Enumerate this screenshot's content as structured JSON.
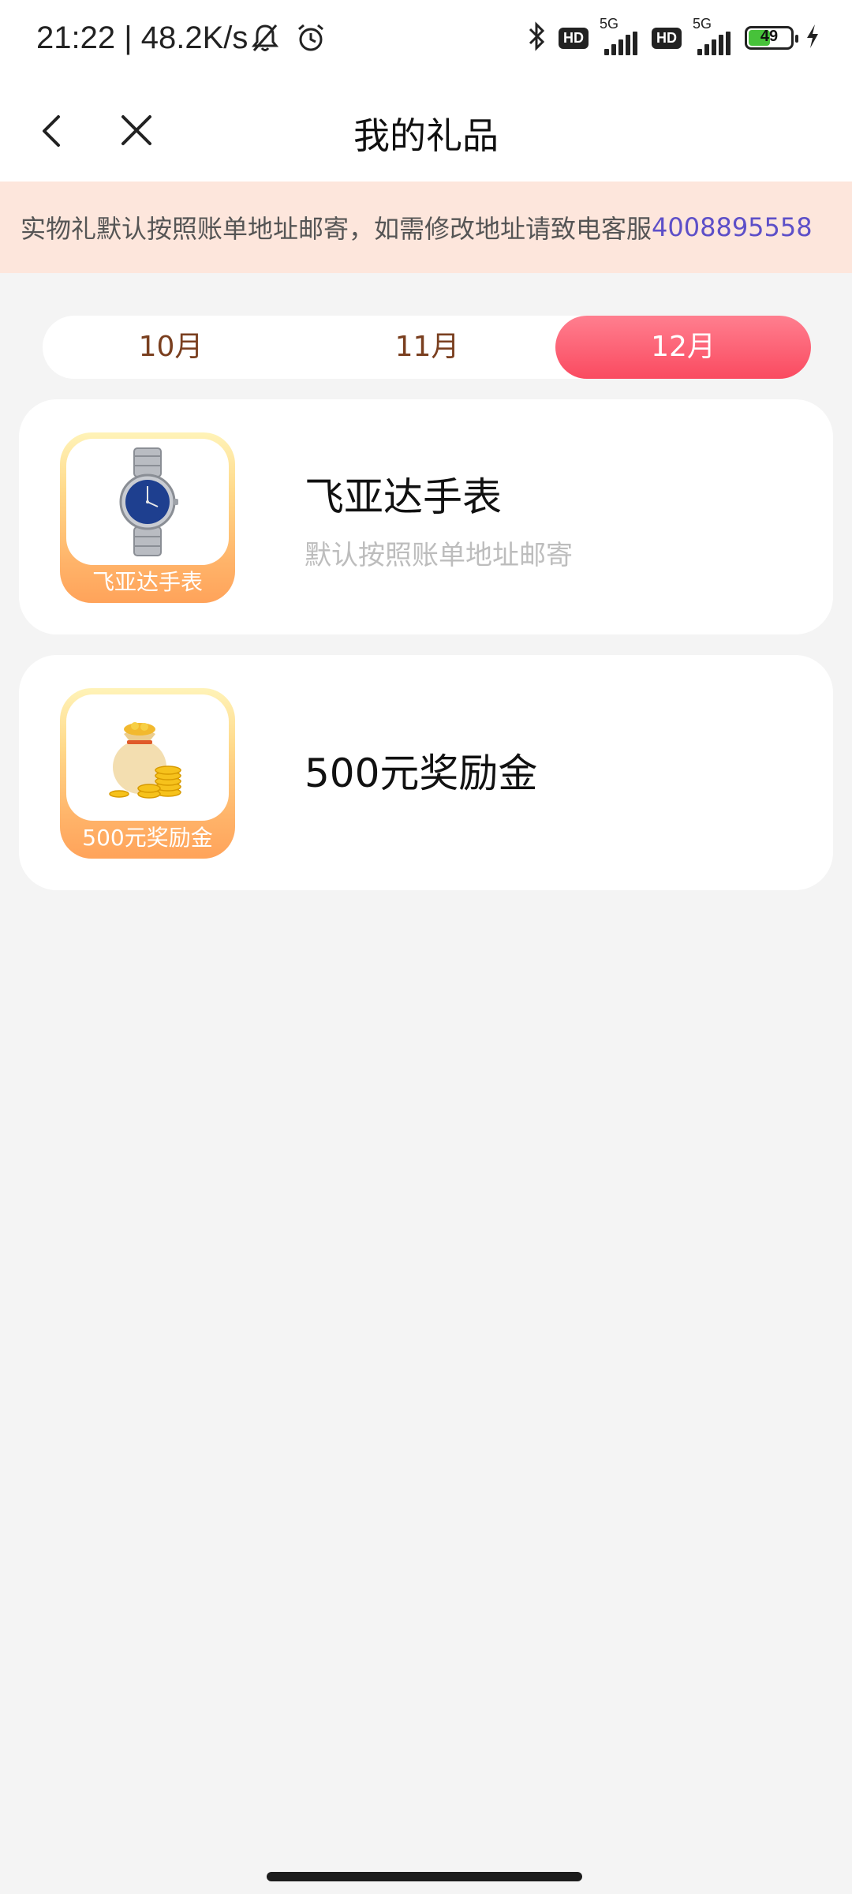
{
  "status_bar": {
    "time_speed": "21:22 | 48.2K/s",
    "icons": [
      "mute-bell-icon",
      "alarm-icon",
      "bluetooth-icon",
      "hd-icon",
      "signal-5g-icon",
      "hd-icon",
      "signal-5g-icon",
      "battery-icon",
      "charging-icon"
    ],
    "hd_label": "HD",
    "network_label": "5G",
    "battery_level": "49",
    "battery_color": "#47c23a"
  },
  "header": {
    "title": "我的礼品",
    "back_icon": "chevron-left-icon",
    "close_icon": "close-icon"
  },
  "notice": {
    "text": "实物礼默认按照账单地址邮寄，如需修改地址请致电客服",
    "phone": "4008895558",
    "background": "#fde6dc",
    "phone_color": "#5d4fc8"
  },
  "tabs": {
    "items": [
      {
        "label": "10月",
        "selected": false
      },
      {
        "label": "11月",
        "selected": false
      },
      {
        "label": "12月",
        "selected": true
      }
    ],
    "active_color": "#fa4a60",
    "text_color": "#7a3f1f"
  },
  "gifts": [
    {
      "name": "飞亚达手表",
      "icon_label": "飞亚达手表",
      "icon": "wristwatch-icon",
      "description": "默认按照账单地址邮寄"
    },
    {
      "name": "500元奖励金",
      "icon_label": "500元奖励金",
      "icon": "money-bag-icon",
      "description": ""
    }
  ]
}
